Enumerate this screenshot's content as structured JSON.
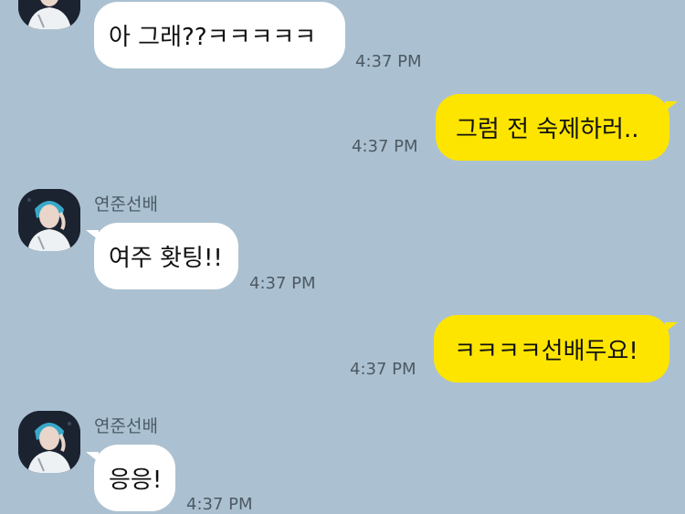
{
  "messages": [
    {
      "text": "아 그래??ㅋㅋㅋㅋㅋ",
      "time": "4:37 PM"
    },
    {
      "text": "그럼 전 숙제하러..",
      "time": "4:37 PM"
    },
    {
      "sender": "연준선배",
      "text": "여주 홧팅!!",
      "time": "4:37 PM"
    },
    {
      "text": "ㅋㅋㅋㅋ선배두요!",
      "time": "4:37 PM"
    },
    {
      "sender": "연준선배",
      "text": "응응!",
      "time": "4:37 PM"
    }
  ],
  "colors": {
    "background": "#abc1d1",
    "incoming_bubble": "#ffffff",
    "outgoing_bubble": "#fee500"
  },
  "icons": {
    "avatar": "profile-photo-avatar"
  }
}
